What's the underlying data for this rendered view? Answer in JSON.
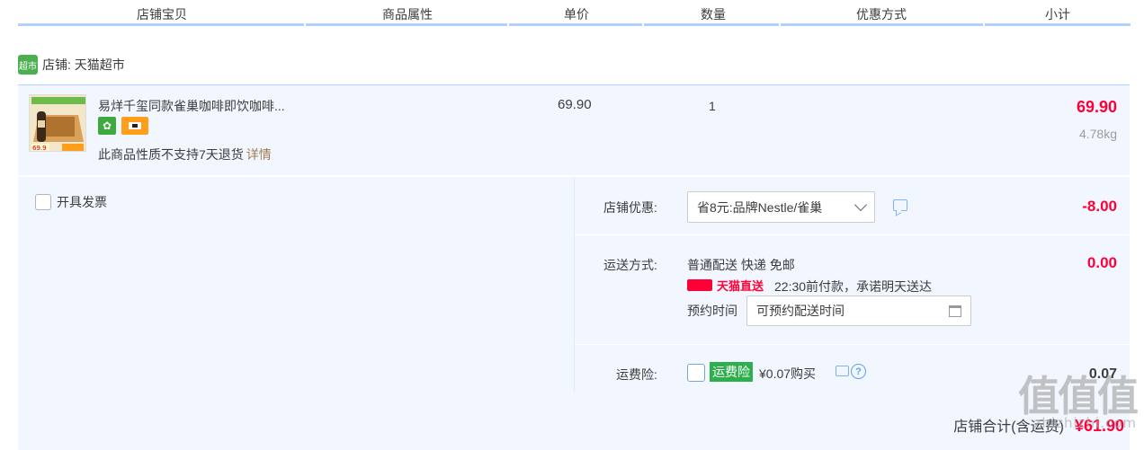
{
  "header": {
    "columns": [
      "店铺宝贝",
      "商品属性",
      "单价",
      "数量",
      "优惠方式",
      "小计"
    ]
  },
  "shop": {
    "badge": "超市",
    "label": "店铺: 天猫超市"
  },
  "item": {
    "title": "易烊千玺同款雀巢咖啡即饮咖啡...",
    "note": "此商品性质不支持7天退货",
    "details_link": "详情",
    "unit_price": "69.90",
    "quantity": "1",
    "subtotal": "69.90",
    "weight": "4.78kg",
    "thumb_price": "69.9"
  },
  "invoice": {
    "label": "开具发票"
  },
  "discount": {
    "label": "店铺优惠:",
    "selected": "省8元:品牌Nestle/雀巢",
    "amount": "-8.00"
  },
  "shipping": {
    "label": "运送方式:",
    "method": "普通配送 快递 免邮",
    "direct_label": "天猫直送",
    "promise": "22:30前付款，承诺明天送达",
    "time_label": "预约时间",
    "time_placeholder": "可预约配送时间",
    "amount": "0.00"
  },
  "insurance": {
    "label": "运费险:",
    "tag": "运费险",
    "price": "¥0.07购买",
    "amount": "0.07"
  },
  "total": {
    "label": "店铺合计(含运费)",
    "amount": "¥61.90"
  },
  "watermark": {
    "big": "值值值",
    "small": "zhizhizhi.com"
  },
  "colors": {
    "accent_red": "#ff0036",
    "header_line": "#b2d1ff",
    "panel_bg": "#f2f7ff",
    "green": "#2eaf4d"
  }
}
